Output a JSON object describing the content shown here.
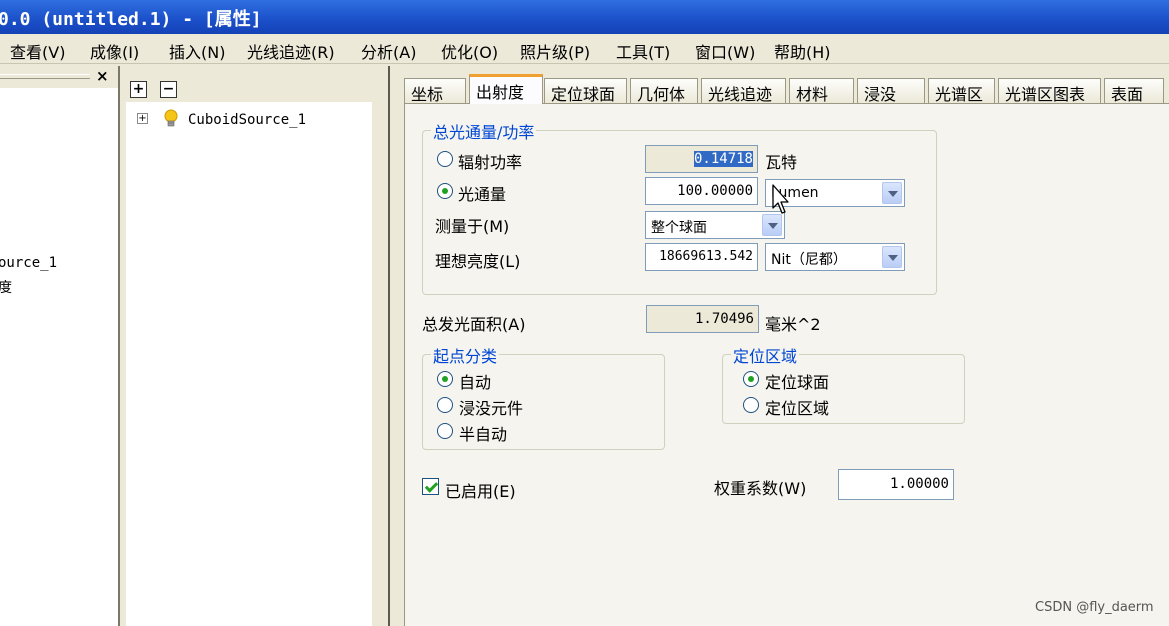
{
  "window": {
    "title": "0.0  (untitled.1) - [属性]"
  },
  "menu": [
    {
      "label": "查看(V)"
    },
    {
      "label": "成像(I)"
    },
    {
      "label": "插入(N)"
    },
    {
      "label": "光线追迹(R)"
    },
    {
      "label": "分析(A)"
    },
    {
      "label": "优化(O)"
    },
    {
      "label": "照片级(P)"
    },
    {
      "label": "工具(T)"
    },
    {
      "label": "窗口(W)"
    },
    {
      "label": "帮助(H)"
    }
  ],
  "left_panel": {
    "close": "×",
    "line1": "ource_1",
    "line2": "度"
  },
  "tree": {
    "expand_btn": "+",
    "collapse_btn": "−",
    "expander": "+",
    "node": "CuboidSource_1"
  },
  "tabs": [
    "坐标",
    "出射度",
    "定位球面",
    "几何体",
    "光线追迹",
    "材料",
    "浸没",
    "光谱区",
    "光谱区图表",
    "表面"
  ],
  "flux_group": {
    "title": "总光通量/功率",
    "radiant_power": {
      "label": "辐射功率",
      "value": "0.14718",
      "unit": "瓦特"
    },
    "luminous_flux": {
      "label": "光通量",
      "value": "100.00000",
      "unit": "Lumen"
    },
    "measure": {
      "label": "测量于(M)",
      "value": "整个球面"
    },
    "ideal_luminance": {
      "label": "理想亮度(L)",
      "value": "18669613.542",
      "unit": "Nit（尼都）"
    }
  },
  "emitting_area": {
    "label": "总发光面积(A)",
    "value": "1.70496",
    "unit": "毫米^2"
  },
  "origin_group": {
    "title": "起点分类",
    "options": [
      "自动",
      "浸没元件",
      "半自动"
    ]
  },
  "aim_group": {
    "title": "定位区域",
    "options": [
      "定位球面",
      "定位区域"
    ]
  },
  "enabled": {
    "label": "已启用(E)"
  },
  "weight": {
    "label": "权重系数(W)",
    "value": "1.00000"
  },
  "watermark": "CSDN @fly_daerm"
}
